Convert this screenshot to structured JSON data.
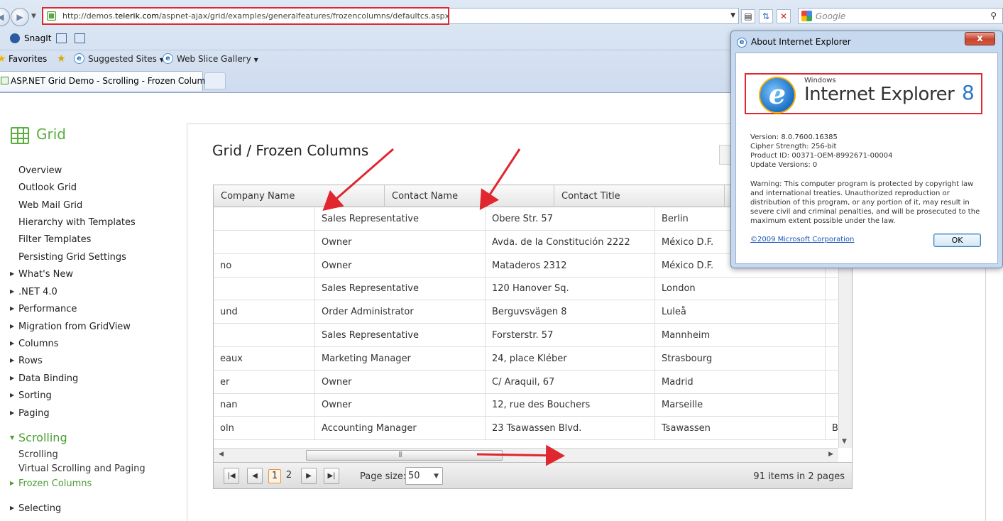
{
  "browser": {
    "url_prefix": "http://demos.",
    "url_domain": "telerik.com",
    "url_path": "/aspnet-ajax/grid/examples/generalfeatures/frozencolumns/defaultcs.aspx",
    "search_placeholder": "Google",
    "snagit_label": "SnagIt",
    "favorites_label": "Favorites",
    "suggested_sites": "Suggested Sites",
    "web_slice_gallery": "Web Slice Gallery",
    "tab_title": "ASP.NET Grid Demo - Scrolling - Frozen Columns"
  },
  "sidebar": {
    "title": "Grid",
    "items": [
      "Overview",
      "Outlook Grid",
      "Web Mail Grid",
      "Hierarchy with Templates",
      "Filter Templates",
      "Persisting Grid Settings"
    ],
    "groups": [
      "What's New",
      ".NET 4.0",
      "Performance",
      "Migration from GridView",
      "Columns",
      "Rows",
      "Data Binding",
      "Sorting",
      "Paging"
    ],
    "active_group": "Scrolling",
    "sub_items": [
      "Scrolling",
      "Virtual Scrolling and Paging"
    ],
    "active_item": "Frozen Columns",
    "next_group": "Selecting"
  },
  "content": {
    "title": "Grid / Frozen Columns"
  },
  "grid": {
    "columns": [
      "Company Name",
      "Contact Name",
      "Contact Title"
    ],
    "rows": [
      [
        "",
        "Sales Representative",
        "Obere Str. 57",
        "Berlin",
        ""
      ],
      [
        "",
        "Owner",
        "Avda. de la Constitución 2222",
        "México D.F.",
        ""
      ],
      [
        "no",
        "Owner",
        "Mataderos 2312",
        "México D.F.",
        ""
      ],
      [
        "",
        "Sales Representative",
        "120 Hanover Sq.",
        "London",
        ""
      ],
      [
        "und",
        "Order Administrator",
        "Berguvsvägen 8",
        "Luleå",
        ""
      ],
      [
        "",
        "Sales Representative",
        "Forsterstr. 57",
        "Mannheim",
        ""
      ],
      [
        "eaux",
        "Marketing Manager",
        "24, place Kléber",
        "Strasbourg",
        ""
      ],
      [
        "er",
        "Owner",
        "C/ Araquil, 67",
        "Madrid",
        ""
      ],
      [
        "nan",
        "Owner",
        "12, rue des Bouchers",
        "Marseille",
        ""
      ],
      [
        "oln",
        "Accounting Manager",
        "23 Tsawassen Blvd.",
        "Tsawassen",
        "B"
      ]
    ],
    "pager": {
      "pages": [
        "1",
        "2"
      ],
      "current_page": "1",
      "page_size_label": "Page size:",
      "page_size": "50",
      "info": "91 items in 2 pages"
    }
  },
  "dialog": {
    "title": "About Internet Explorer",
    "close": "x",
    "logo_windows": "Windows",
    "logo_product": "Internet Explorer",
    "logo_version": "8",
    "version": "Version: 8.0.7600.16385",
    "cipher": "Cipher Strength: 256-bit",
    "product_id": "Product ID: 00371-OEM-8992671-00004",
    "update_versions": "Update Versions: 0",
    "warning": "Warning: This computer program is protected by copyright law and international treaties. Unauthorized reproduction or distribution of this program, or any portion of it, may result in severe civil and criminal penalties, and will be prosecuted to the maximum extent possible under the law.",
    "copyright": "©2009 Microsoft Corporation",
    "ok": "OK"
  },
  "colors": {
    "accent_green": "#5aae3e",
    "annotation_red": "#e0262e"
  }
}
